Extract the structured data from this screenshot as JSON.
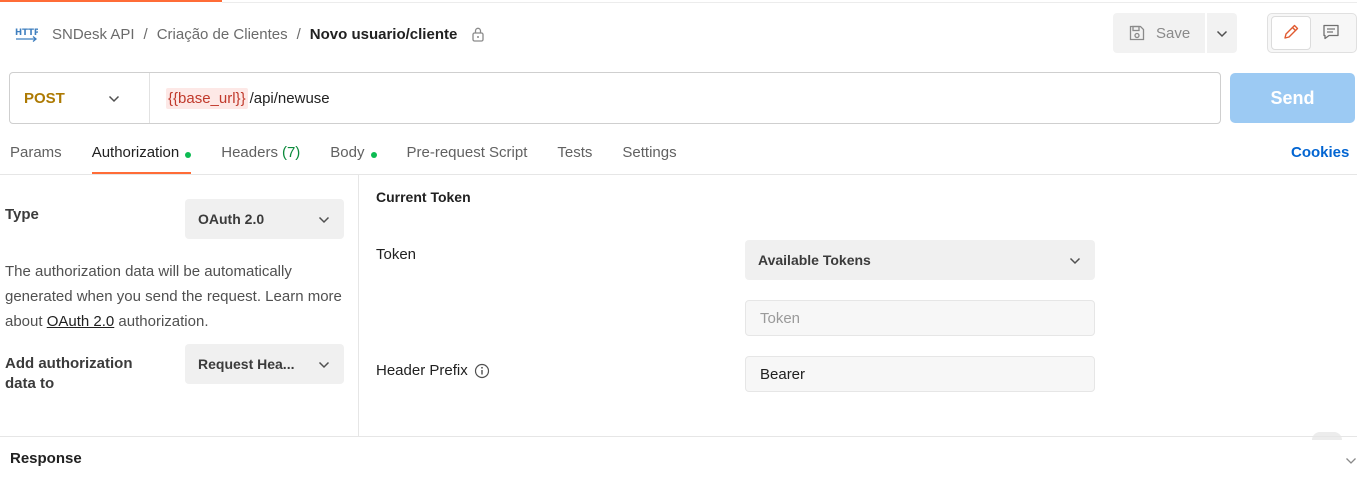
{
  "breadcrumb": {
    "items": [
      "SNDesk API",
      "Criação de Clientes"
    ],
    "current": "Novo usuario/cliente",
    "separator": "/"
  },
  "icons": {
    "request_type": "http-icon",
    "lock": "lock-icon",
    "save": "save-icon",
    "edit": "pencil-icon",
    "comments": "comment-icon",
    "info": "info-icon"
  },
  "toolbar": {
    "save_label": "Save"
  },
  "request": {
    "method": "POST",
    "url_variable": "{{base_url}}",
    "url_path": "/api/newuse",
    "send_label": "Send"
  },
  "tabs": [
    {
      "label": "Params"
    },
    {
      "label": "Authorization",
      "dot": true
    },
    {
      "label": "Headers",
      "count": "(7)"
    },
    {
      "label": "Body",
      "dot": true
    },
    {
      "label": "Pre-request Script"
    },
    {
      "label": "Tests"
    },
    {
      "label": "Settings"
    }
  ],
  "cookies_label": "Cookies",
  "auth": {
    "type_label": "Type",
    "type_value": "OAuth 2.0",
    "description_before": "The authorization data will be automatically generated when you send the request. Learn more about ",
    "description_link": "OAuth 2.0",
    "description_after": " authorization.",
    "add_to_label": "Add authorization data to",
    "add_to_value": "Request Hea..."
  },
  "token": {
    "section_title": "Current Token",
    "token_label": "Token",
    "available_tokens": "Available Tokens",
    "token_placeholder": "Token",
    "header_prefix_label": "Header Prefix",
    "header_prefix_value": "Bearer"
  },
  "response": {
    "label": "Response"
  },
  "colors": {
    "accent": "#ff6c37",
    "method_post": "#ad7a03",
    "send_disabled": "#9ccaf3",
    "link": "#0265d2",
    "status_dot": "#0cbb52"
  }
}
